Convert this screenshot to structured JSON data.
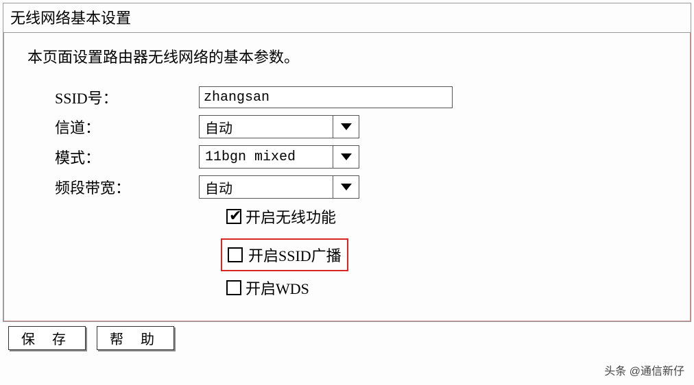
{
  "panel": {
    "title": "无线网络基本设置",
    "description": "本页面设置路由器无线网络的基本参数。"
  },
  "form": {
    "ssid": {
      "label": "SSID号：",
      "value": "zhangsan"
    },
    "channel": {
      "label": "信道：",
      "value": "自动"
    },
    "mode": {
      "label": "模式：",
      "value": "11bgn mixed"
    },
    "bandwidth": {
      "label": "频段带宽：",
      "value": "自动"
    },
    "enable_wireless": {
      "label": "开启无线功能",
      "checked": true
    },
    "enable_ssid_broadcast": {
      "label": "开启SSID广播",
      "checked": false
    },
    "enable_wds": {
      "label": "开启WDS",
      "checked": false
    }
  },
  "buttons": {
    "save": "保 存",
    "help": "帮 助"
  },
  "watermark": "头条 @通信新仔"
}
